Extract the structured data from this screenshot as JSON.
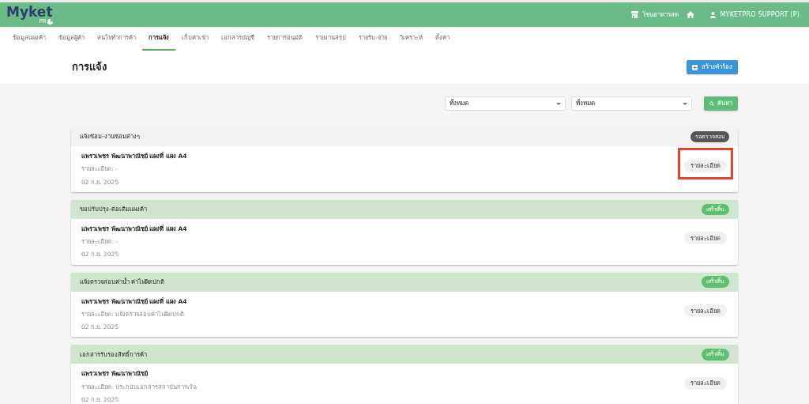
{
  "header": {
    "logo": "Myket",
    "logo_sub": "PR",
    "shop": "โซนอาหารสด",
    "user": "MYKETPRO SUPPORT (P)"
  },
  "tabs": [
    {
      "label": "ข้อมูลแผงค้า",
      "selected": false
    },
    {
      "label": "ข้อมูลผู้ค้า",
      "selected": false
    },
    {
      "label": "สนใจทำการค้า",
      "selected": false
    },
    {
      "label": "การแจ้ง",
      "selected": true
    },
    {
      "label": "เก็บค่าเช่า",
      "selected": false
    },
    {
      "label": "เอกสารบัญชี",
      "selected": false
    },
    {
      "label": "รายการอนุมัติ",
      "selected": false
    },
    {
      "label": "รายงานสรุป",
      "selected": false
    },
    {
      "label": "รายรับ-จ่าย",
      "selected": false
    },
    {
      "label": "วิเคราะห์",
      "selected": false
    },
    {
      "label": "ตั้งค่า",
      "selected": false
    }
  ],
  "page": {
    "title": "การแจ้ง",
    "create_button": "สร้างคำร้อง"
  },
  "filters": {
    "selects": [
      "ทั้งหมด",
      "ทั้งหมด"
    ],
    "search_button": "ค้นหา"
  },
  "cards": [
    {
      "title": "แจ้งซ่อม-งานซ่อมต่างๆ",
      "kind": "pending",
      "badge": "รอตรวจสอบ",
      "name": "แพรวเพชร พัฒนาพาณิชย์ แผงที่ แผง A4",
      "detail": "รายละเอียด: -",
      "date": "02 ก.ย. 2025",
      "button": "รายละเอียด",
      "highlighted": true
    },
    {
      "title": "ขอปรับปรุง-ต่อเติมแผงค้า",
      "kind": "done",
      "badge": "เสร็จสิ้น",
      "name": "แพรวเพชร พัฒนาพาณิชย์ แผงที่ แผง A4",
      "detail": "รายละเอียด: -",
      "date": "02 ก.ย. 2025",
      "button": "รายละเอียด",
      "highlighted": false
    },
    {
      "title": "แจ้งตรวจสอบค่าน้ำ ค่าไฟผิดปกติ",
      "kind": "done",
      "badge": "เสร็จสิ้น",
      "name": "แพรวเพชร พัฒนาพาณิชย์ แผงที่ แผง A4",
      "detail": "รายละเอียด: แจ้งตรวจสอบค่าไฟผิดปกติ",
      "date": "02 ก.ย. 2025",
      "button": "รายละเอียด",
      "highlighted": false
    },
    {
      "title": "เอกสารรับรองสิทธิ์การค้า",
      "kind": "done",
      "badge": "เสร็จสิ้น",
      "name": "แพรวเพชร พัฒนาพาณิชย์",
      "detail": "รายละเอียด: ประกอบเอกสารสถาบันการเงิน",
      "date": "02 ก.ย. 2025",
      "button": "รายละเอียด",
      "highlighted": false
    }
  ]
}
